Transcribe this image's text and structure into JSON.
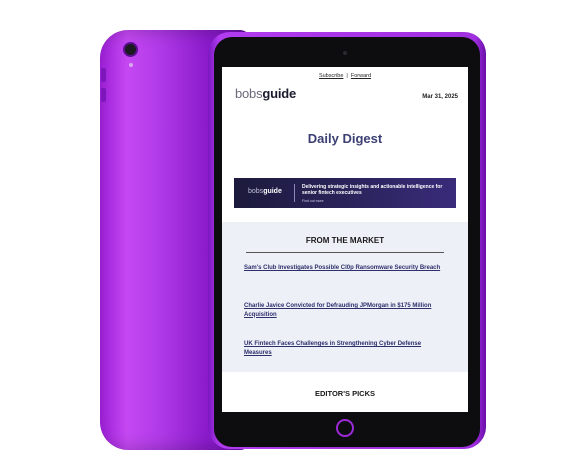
{
  "email": {
    "top_links": {
      "subscribe": "Subscribe",
      "separator": "|",
      "forward": "Forward"
    },
    "logo": {
      "light": "bobs",
      "bold": "guide"
    },
    "date": "Mar 31, 2025",
    "title": "Daily Digest",
    "banner": {
      "logo_light": "bobs",
      "logo_bold": "guide",
      "headline": "Delivering strategic insights and actionable intelligence for senior fintech executives",
      "cta": "Find out more"
    },
    "market": {
      "heading": "FROM THE MARKET",
      "items": [
        "Sam's Club Investigates Possible Cl0p Ransomware Security Breach",
        "Charlie Javice Convicted for Defrauding JPMorgan in $175 Million Acquisition",
        "UK Fintech Faces Challenges in Strengthening Cyber Defense Measures"
      ]
    },
    "picks_heading": "EDITOR'S PICKS"
  },
  "device": {
    "color": "#b03ae8"
  }
}
